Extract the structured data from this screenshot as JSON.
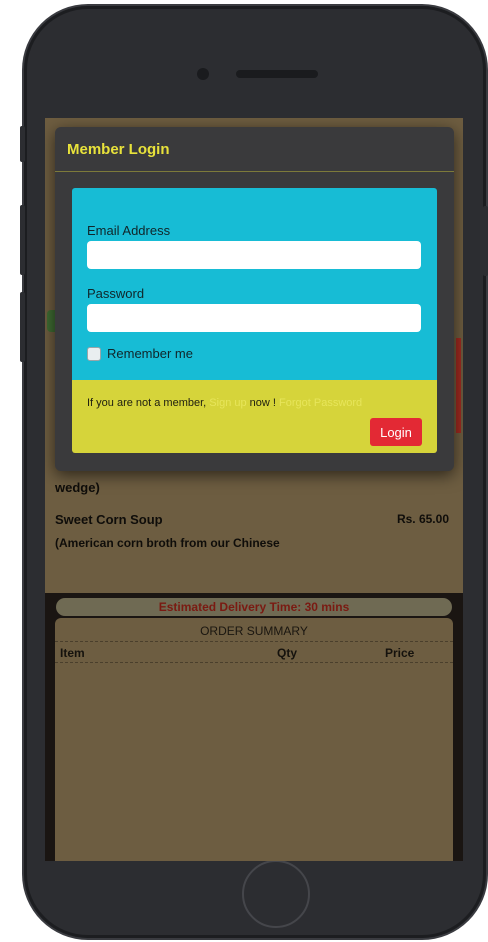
{
  "modal": {
    "title": "Member Login",
    "email_label": "Email Address",
    "email_value": "",
    "password_label": "Password",
    "password_value": "",
    "remember_label": "Remember me",
    "footer_prefix": "If you are not a member,",
    "signup_link": "Sign up",
    "footer_middle": "now !",
    "forgot_link": "Forgot Password",
    "login_button": "Login"
  },
  "menu": {
    "item_partial_desc": "wedge)",
    "item_name": "Sweet Corn Soup",
    "item_price": "Rs. 65.00",
    "item_desc": "(American corn broth from our Chinese"
  },
  "delivery": {
    "text": "Estimated Delivery Time: 30 mins"
  },
  "order_summary": {
    "title": "ORDER SUMMARY",
    "columns": [
      "Item",
      "Qty",
      "Price"
    ]
  },
  "colors": {
    "modal_title": "#e8e23b",
    "form_panel": "#17bcd5",
    "footer_panel": "#d6d43a",
    "login_button": "#e32934",
    "delivery_text": "#7a1a12"
  }
}
